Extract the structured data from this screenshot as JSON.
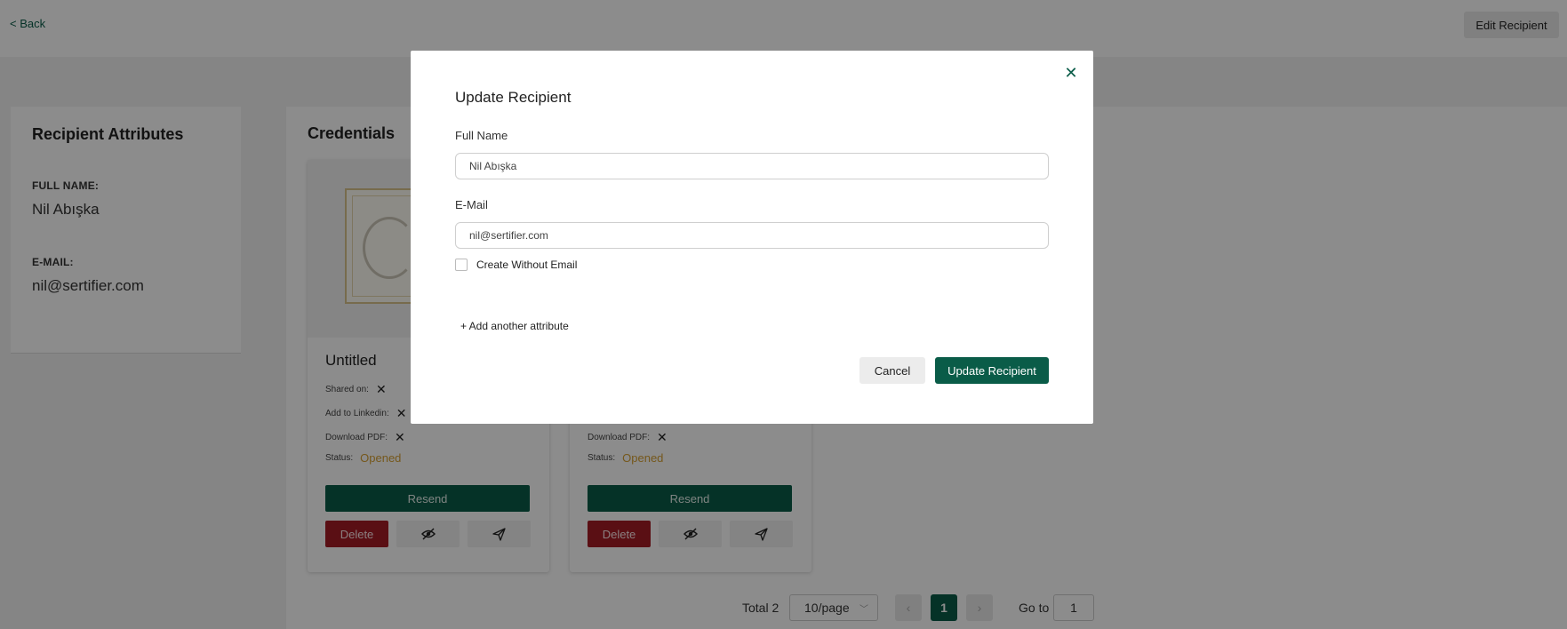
{
  "header": {
    "back_label": "< Back",
    "edit_label": "Edit Recipient"
  },
  "attributes": {
    "title": "Recipient Attributes",
    "full_name_label": "FULL NAME:",
    "full_name_value": "Nil Abışka",
    "email_label": "E-MAIL:",
    "email_value": "nil@sertifier.com"
  },
  "credentials": {
    "title": "Credentials",
    "cards": [
      {
        "name": "Untitled",
        "shared_on_label": "Shared on:",
        "linkedin_label": "Add to Linkedin:",
        "download_label": "Download PDF:",
        "status_label": "Status:",
        "status_value": "Opened",
        "resend_label": "Resend",
        "delete_label": "Delete"
      },
      {
        "name": "",
        "shared_on_label": "",
        "linkedin_label": "",
        "download_label": "Download PDF:",
        "status_label": "Status:",
        "status_value": "Opened",
        "resend_label": "Resend",
        "delete_label": "Delete"
      }
    ]
  },
  "pagination": {
    "total_label": "Total 2",
    "page_size": "10/page",
    "current_page": "1",
    "goto_label": "Go to",
    "goto_value": "1"
  },
  "modal": {
    "title": "Update Recipient",
    "full_name_label": "Full Name",
    "full_name_value": "Nil Abışka",
    "email_label": "E-Mail",
    "email_value": "nil@sertifier.com",
    "create_without_email_label": "Create Without Email",
    "add_attribute_label": "+ Add another attribute",
    "cancel_label": "Cancel",
    "submit_label": "Update Recipient"
  },
  "colors": {
    "brand_green": "#0a5c48",
    "danger_red": "#a51d26",
    "status_orange": "#d6a033"
  }
}
